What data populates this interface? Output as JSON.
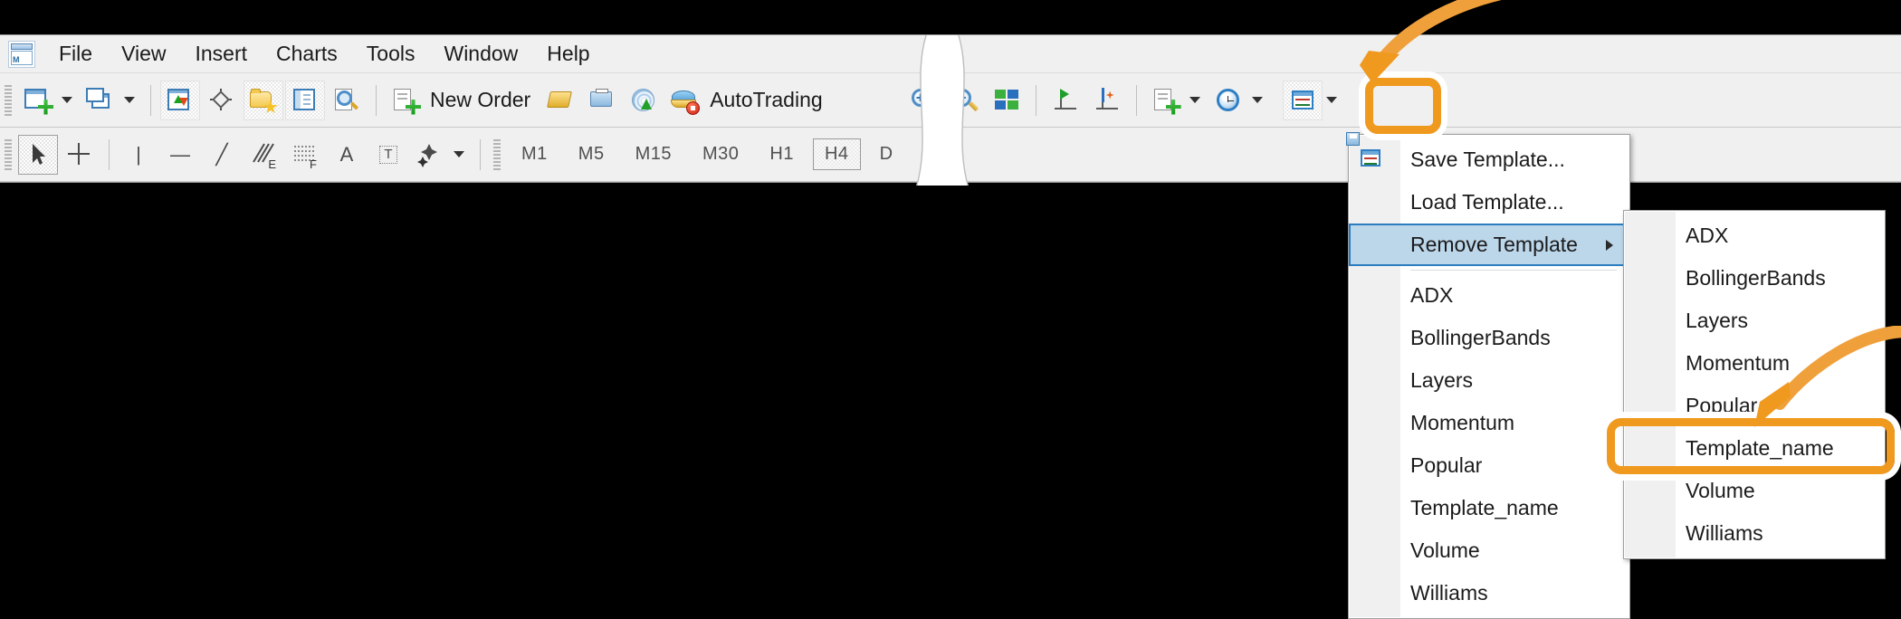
{
  "app": {
    "logo_icon": "metatrader-chart-icon",
    "logo_letter": "M"
  },
  "menubar": {
    "items": [
      {
        "label": "File"
      },
      {
        "label": "View"
      },
      {
        "label": "Insert"
      },
      {
        "label": "Charts"
      },
      {
        "label": "Tools"
      },
      {
        "label": "Window"
      },
      {
        "label": "Help"
      }
    ]
  },
  "toolbar_main": {
    "new_chart": {
      "name": "new-chart-button",
      "icon": "new-chart-icon"
    },
    "profiles": {
      "name": "profiles-button",
      "icon": "profiles-icon"
    },
    "market_watch": {
      "name": "market-watch-button",
      "icon": "market-watch-icon"
    },
    "data_window": {
      "name": "data-window-button",
      "icon": "crosshair-data-window-icon"
    },
    "navigator": {
      "name": "navigator-button",
      "icon": "folder-star-icon"
    },
    "terminal": {
      "name": "terminal-button",
      "icon": "terminal-list-icon"
    },
    "strategy_tester": {
      "name": "strategy-tester-button",
      "icon": "magnifier-chart-icon"
    },
    "new_order_label": "New Order",
    "new_order_icon": "new-order-icon",
    "metaeditor": {
      "name": "metaeditor-button",
      "icon": "gold-slab-icon"
    },
    "print": {
      "name": "print-button",
      "icon": "printer-icon"
    },
    "signals": {
      "name": "signals-button",
      "icon": "radar-signal-icon"
    },
    "autotrading_label": "AutoTrading",
    "autotrading_icon": "autotrading-hat-icon",
    "zoom_in": {
      "name": "zoom-in-button",
      "icon": "zoom-in-icon",
      "glyph": "+"
    },
    "zoom_out": {
      "name": "zoom-out-button",
      "icon": "zoom-out-icon",
      "glyph": "−"
    },
    "tile_windows": {
      "name": "tile-windows-button",
      "icon": "tile-windows-icon"
    },
    "shift_end": {
      "name": "chart-shift-button",
      "icon": "chart-shift-icon"
    },
    "auto_scroll": {
      "name": "auto-scroll-button",
      "icon": "auto-scroll-icon"
    },
    "indicators": {
      "name": "indicators-button",
      "icon": "indicator-add-icon"
    },
    "periods": {
      "name": "periods-button",
      "icon": "clock-periods-icon"
    },
    "templates": {
      "name": "templates-button",
      "icon": "templates-chart-icon"
    }
  },
  "toolbar_line": {
    "cursor": {
      "name": "cursor-tool",
      "icon": "arrow-cursor-icon"
    },
    "crosshair": {
      "name": "crosshair-tool",
      "icon": "crosshair-icon"
    },
    "vertical_line": {
      "name": "vertical-line-tool",
      "icon": "vertical-line-icon",
      "glyph": "|"
    },
    "horizontal_line": {
      "name": "horizontal-line-tool",
      "icon": "horizontal-line-icon",
      "glyph": "—"
    },
    "trendline": {
      "name": "trendline-tool",
      "icon": "trendline-icon",
      "glyph": "╱"
    },
    "equidistant_channel": {
      "name": "equidistant-channel-tool",
      "icon": "equidistant-channel-icon",
      "glyph": "E"
    },
    "fibonacci": {
      "name": "fibonacci-tool",
      "icon": "fibonacci-retracement-icon",
      "glyph": "F"
    },
    "text": {
      "name": "text-tool",
      "icon": "text-icon",
      "glyph": "A"
    },
    "text_label": {
      "name": "text-label-tool",
      "icon": "text-label-icon",
      "glyph": "T"
    },
    "shapes": {
      "name": "shapes-tool",
      "icon": "shapes-arrows-icon"
    },
    "timeframes": [
      {
        "label": "M1",
        "selected": false
      },
      {
        "label": "M5",
        "selected": false
      },
      {
        "label": "M15",
        "selected": false
      },
      {
        "label": "M30",
        "selected": false
      },
      {
        "label": "H1",
        "selected": false
      },
      {
        "label": "H4",
        "selected": true
      },
      {
        "label": "D",
        "selected": false
      }
    ]
  },
  "template_menu": {
    "name": "templates-dropdown-menu",
    "items": [
      {
        "label": "Save Template...",
        "icon": "save-template-icon",
        "selected": false,
        "submenu": false
      },
      {
        "label": "Load Template...",
        "icon": "",
        "selected": false,
        "submenu": false
      },
      {
        "label": "Remove Template",
        "icon": "",
        "selected": true,
        "submenu": true
      },
      {
        "label": "ADX",
        "icon": "",
        "selected": false,
        "submenu": false
      },
      {
        "label": "BollingerBands",
        "icon": "",
        "selected": false,
        "submenu": false
      },
      {
        "label": "Layers",
        "icon": "",
        "selected": false,
        "submenu": false
      },
      {
        "label": "Momentum",
        "icon": "",
        "selected": false,
        "submenu": false
      },
      {
        "label": "Popular",
        "icon": "",
        "selected": false,
        "submenu": false
      },
      {
        "label": "Template_name",
        "icon": "",
        "selected": false,
        "submenu": false
      },
      {
        "label": "Volume",
        "icon": "",
        "selected": false,
        "submenu": false
      },
      {
        "label": "Williams",
        "icon": "",
        "selected": false,
        "submenu": false
      }
    ],
    "separator_after_index": 2
  },
  "remove_submenu": {
    "name": "remove-template-submenu",
    "items": [
      {
        "label": "ADX"
      },
      {
        "label": "BollingerBands"
      },
      {
        "label": "Layers"
      },
      {
        "label": "Momentum"
      },
      {
        "label": "Popular"
      },
      {
        "label": "Template_name"
      },
      {
        "label": "Volume"
      },
      {
        "label": "Williams"
      }
    ],
    "highlighted_label": "Template_name"
  },
  "annotations": {
    "accent_color": "#f0991f",
    "highlight_toolbar_target": "templates-toolbar-button",
    "highlight_menu_target": "Template_name",
    "arrow_top_name": "callout-arrow-to-templates-button",
    "arrow_sub_name": "callout-arrow-to-template-name"
  },
  "colors": {
    "chart_background": "#000000",
    "toolbar_background": "#f0f0f0",
    "menu_background": "#ffffff",
    "menu_gutter": "#f0f0f0",
    "selection_fill": "#bcd6ea",
    "selection_border": "#2b7dc0",
    "accent_orange": "#f0991f"
  }
}
